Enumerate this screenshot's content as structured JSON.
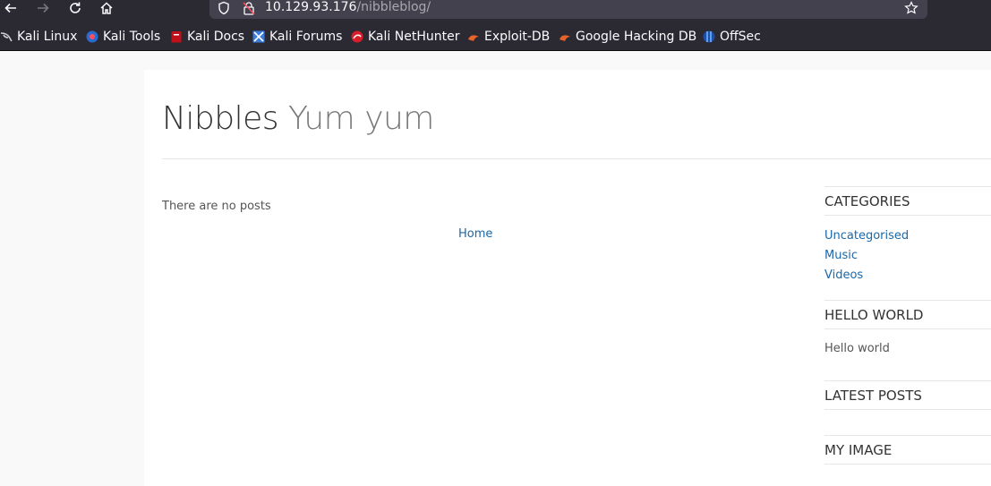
{
  "browser": {
    "url_host": "10.129.93.176",
    "url_path": "/nibbleblog/",
    "bookmarks": [
      {
        "label": "Kali Linux",
        "icon": "kali-dragon-icon"
      },
      {
        "label": "Kali Tools",
        "icon": "kali-tools-icon"
      },
      {
        "label": "Kali Docs",
        "icon": "kali-docs-icon"
      },
      {
        "label": "Kali Forums",
        "icon": "kali-forums-icon"
      },
      {
        "label": "Kali NetHunter",
        "icon": "kali-nethunter-icon"
      },
      {
        "label": "Exploit-DB",
        "icon": "exploit-db-icon"
      },
      {
        "label": "Google Hacking DB",
        "icon": "google-hacking-db-icon"
      },
      {
        "label": "OffSec",
        "icon": "offsec-icon"
      }
    ]
  },
  "site": {
    "name": "Nibbles",
    "slogan": "Yum yum"
  },
  "main": {
    "empty_text": "There are no posts",
    "pager_home": "Home"
  },
  "sidebar": {
    "categories": {
      "title": "CATEGORIES",
      "items": [
        "Uncategorised",
        "Music",
        "Videos"
      ]
    },
    "hello": {
      "title": "HELLO WORLD",
      "text": "Hello world"
    },
    "latest": {
      "title": "LATEST POSTS"
    },
    "image": {
      "title": "MY IMAGE"
    }
  },
  "colors": {
    "chrome_bg": "#2b2a33",
    "link": "#1b67a8"
  }
}
